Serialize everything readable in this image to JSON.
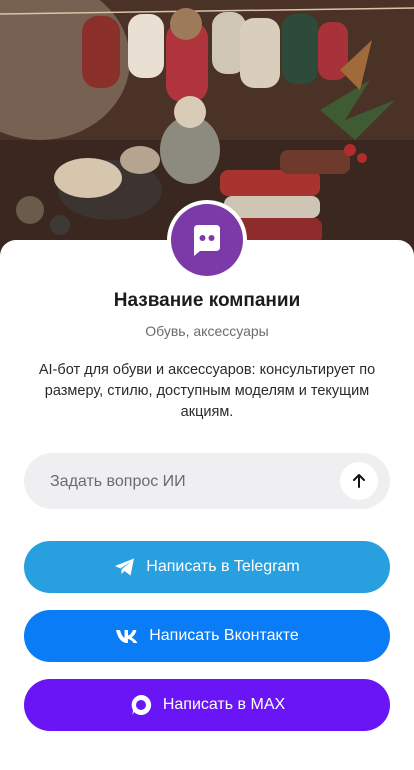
{
  "profile": {
    "company_name": "Название компании",
    "category": "Обувь, аксессуары",
    "description": "AI-бот для обуви и аксессуаров: консультирует по размеру, стилю, доступным моделям и текущим акциям."
  },
  "ask": {
    "placeholder": "Задать вопрос ИИ"
  },
  "buttons": {
    "telegram": "Написать в Telegram",
    "vk": "Написать Вконтакте",
    "max": "Написать в MAX"
  },
  "colors": {
    "avatar_bg": "#7b3aa8",
    "telegram": "#28a0e0",
    "vk": "#0a7cf5",
    "max": "#6a15f5"
  }
}
